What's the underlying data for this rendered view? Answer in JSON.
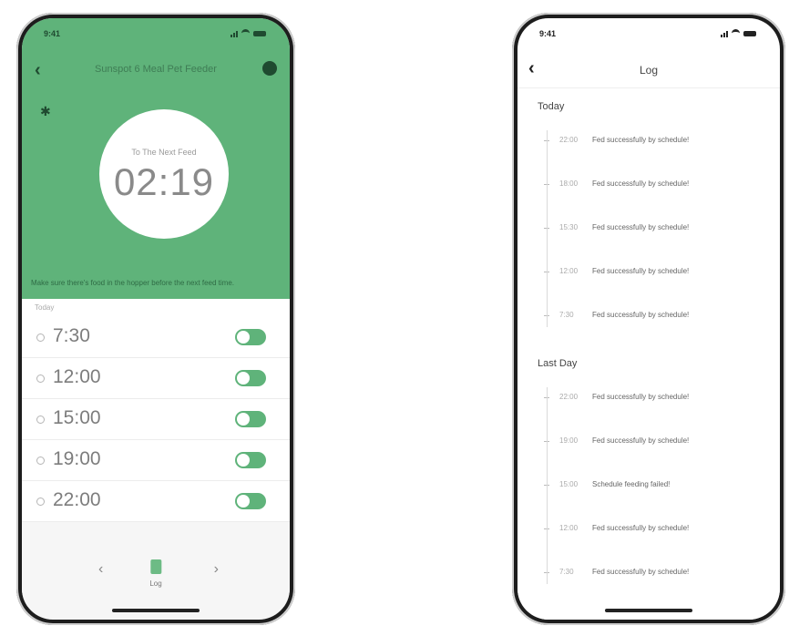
{
  "feeder": {
    "status_time": "9:41",
    "title": "Sunspot 6 Meal Pet Feeder",
    "countdown_label": "To The Next Feed",
    "countdown": "02:19",
    "notice": "Make sure there's food in the hopper before the next feed time.",
    "schedule_header": "Today",
    "schedule": [
      {
        "time": "7:30",
        "enabled": true
      },
      {
        "time": "12:00",
        "enabled": true
      },
      {
        "time": "15:00",
        "enabled": true
      },
      {
        "time": "19:00",
        "enabled": true
      },
      {
        "time": "22:00",
        "enabled": true
      }
    ],
    "nav": {
      "prev": "‹",
      "center_label": "Log",
      "next": "›"
    },
    "colors": {
      "primary": "#5fb37a"
    }
  },
  "log": {
    "status_time": "9:41",
    "title": "Log",
    "back": "‹",
    "sections": [
      {
        "label": "Today",
        "entries": [
          {
            "time": "22:00",
            "message": "Fed successfully by schedule!"
          },
          {
            "time": "18:00",
            "message": "Fed successfully by schedule!"
          },
          {
            "time": "15:30",
            "message": "Fed successfully by schedule!"
          },
          {
            "time": "12:00",
            "message": "Fed successfully by schedule!"
          },
          {
            "time": "7:30",
            "message": "Fed successfully by schedule!"
          }
        ]
      },
      {
        "label": "Last Day",
        "entries": [
          {
            "time": "22:00",
            "message": "Fed successfully by schedule!"
          },
          {
            "time": "19:00",
            "message": "Fed successfully by schedule!"
          },
          {
            "time": "15:00",
            "message": "Schedule feeding failed!"
          },
          {
            "time": "12:00",
            "message": "Fed successfully by schedule!"
          },
          {
            "time": "7:30",
            "message": "Fed successfully by schedule!"
          }
        ]
      }
    ]
  }
}
